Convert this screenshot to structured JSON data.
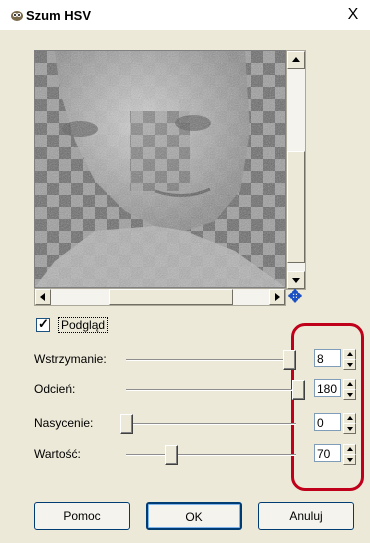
{
  "window": {
    "title": "Szum HSV",
    "close_label": "X"
  },
  "preview": {
    "checkbox_label": "Podgląd",
    "checked": true
  },
  "params": [
    {
      "label": "Wstrzymanie:",
      "value": "8",
      "slider_fraction": 0.95
    },
    {
      "label": "Odcień:",
      "value": "180",
      "slider_fraction": 1.0
    },
    {
      "label": "Nasycenie:",
      "value": "0",
      "slider_fraction": 0.0
    },
    {
      "label": "Wartość:",
      "value": "70",
      "slider_fraction": 0.26
    }
  ],
  "buttons": {
    "help": "Pomoc",
    "ok": "OK",
    "cancel": "Anuluj"
  },
  "colors": {
    "highlight": "#c0001a",
    "dialog_bg": "#ece9d8"
  }
}
